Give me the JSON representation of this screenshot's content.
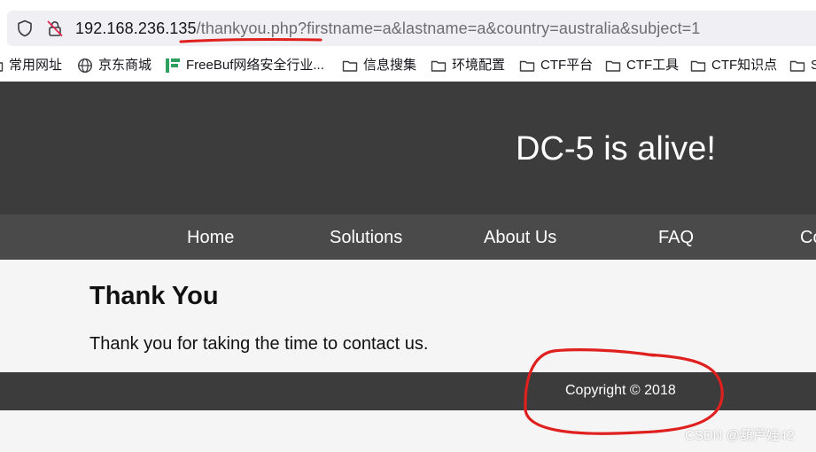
{
  "browser": {
    "url_host": "192.168.236.135",
    "url_path": "/thankyou.php?firstname=a&lastname=a&country=australia&subject=1",
    "icons": [
      "shield-icon",
      "lock-insecure-icon"
    ]
  },
  "bookmarks": [
    {
      "label": "常用网址",
      "icon": "folder-icon"
    },
    {
      "label": "京东商城",
      "icon": "globe-icon"
    },
    {
      "label": "FreeBuf网络安全行业...",
      "icon": "freebuf-icon"
    },
    {
      "label": "信息搜集",
      "icon": "folder-icon"
    },
    {
      "label": "环境配置",
      "icon": "folder-icon"
    },
    {
      "label": "CTF平台",
      "icon": "folder-icon"
    },
    {
      "label": "CTF工具",
      "icon": "folder-icon"
    },
    {
      "label": "CTF知识点",
      "icon": "folder-icon"
    },
    {
      "label": "S",
      "icon": "folder-icon"
    }
  ],
  "site": {
    "title": "DC-5 is alive!",
    "nav": [
      "Home",
      "Solutions",
      "About Us",
      "FAQ",
      "Co"
    ],
    "heading": "Thank You",
    "message": "Thank you for taking the time to contact us.",
    "footer": "Copyright © 2018"
  },
  "watermark": "CSDN @葫芦娃42",
  "colors": {
    "header_bg": "#3c3c3c",
    "nav_bg": "#4a4a4a",
    "annotation_red": "#e0201f"
  }
}
